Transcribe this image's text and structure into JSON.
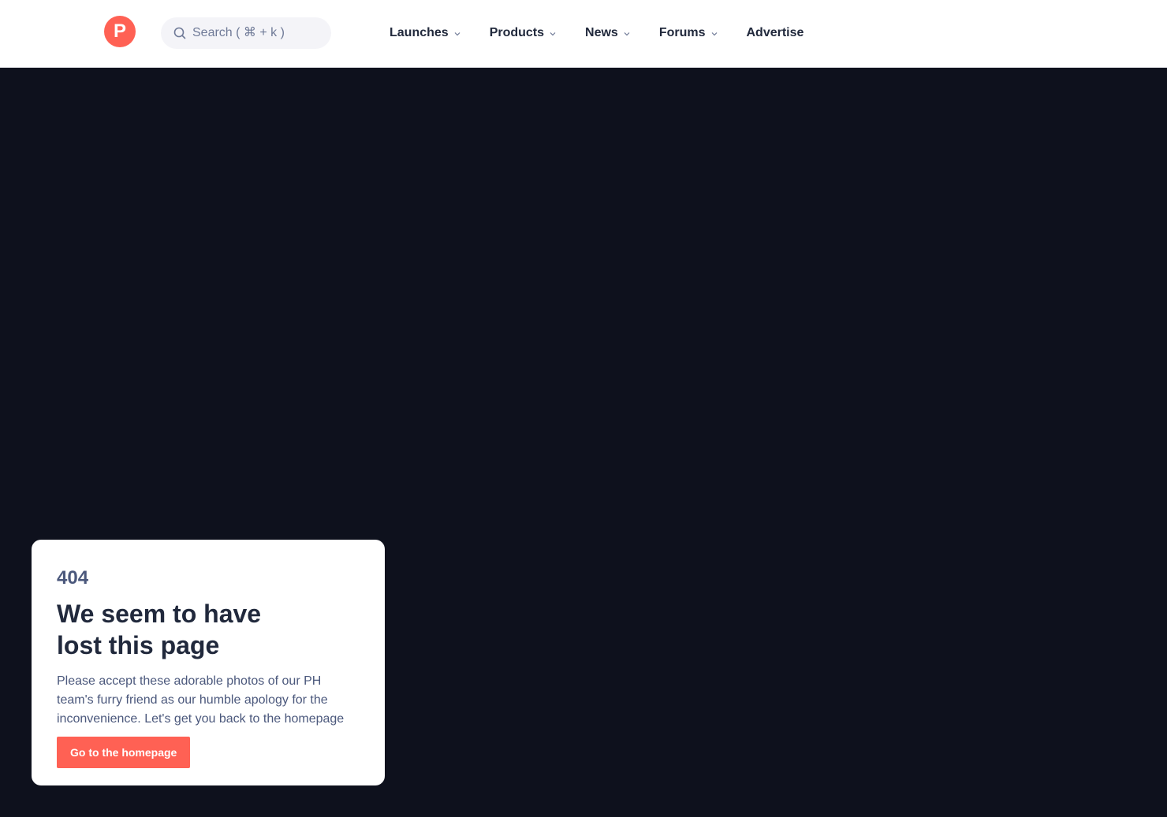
{
  "header": {
    "logo_letter": "P",
    "search": {
      "placeholder": "Search ( ⌘ + k )"
    },
    "nav": [
      {
        "label": "Launches",
        "has_dropdown": true
      },
      {
        "label": "Products",
        "has_dropdown": true
      },
      {
        "label": "News",
        "has_dropdown": true
      },
      {
        "label": "Forums",
        "has_dropdown": true
      },
      {
        "label": "Advertise",
        "has_dropdown": false
      }
    ]
  },
  "error_card": {
    "code": "404",
    "title": "We seem to have lost this page",
    "description": "Please accept these adorable photos of our PH team's furry friend as our humble apology for the inconvenience. Let's get you back to the homepage",
    "button_label": "Go to the homepage"
  },
  "colors": {
    "brand": "#ff6154",
    "background_dark": "#0e111d",
    "text_primary": "#21293c",
    "text_secondary": "#4b587c"
  }
}
